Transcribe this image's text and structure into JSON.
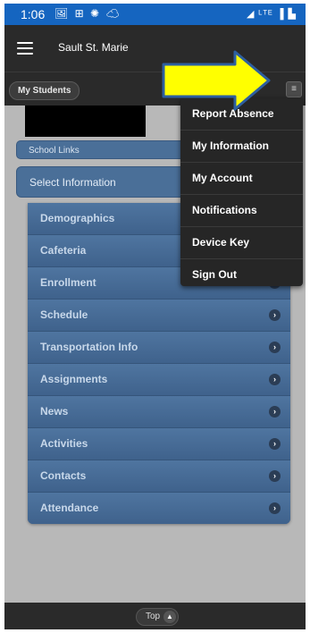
{
  "status_bar": {
    "time": "1:06",
    "notification_icons": "🖼 ⊞ ✺ ☁",
    "system_icons": "◢ ᴸᵀᴱ ▐ ▙"
  },
  "app_bar": {
    "title": "Sault St. Marie"
  },
  "sub_bar": {
    "my_students_label": "My Students",
    "menu_icon": "≡"
  },
  "school_links": {
    "label": "School Links"
  },
  "select_information": {
    "label": "Select Information"
  },
  "info_items": [
    "Demographics",
    "Cafeteria",
    "Enrollment",
    "Schedule",
    "Transportation Info",
    "Assignments",
    "News",
    "Activities",
    "Contacts",
    "Attendance"
  ],
  "dropdown_menu": [
    "Report Absence",
    "My Information",
    "My Account",
    "Notifications",
    "Device Key",
    "Sign Out"
  ],
  "bottom_bar": {
    "top_label": "Top"
  },
  "colors": {
    "accent_blue": "#1565c0",
    "arrow_yellow": "#ffff00",
    "list_blue": "#46699a",
    "dark_bar": "#2a2a2a"
  },
  "icons": {
    "chevron": "chevron-right-icon",
    "up": "chevron-up-icon"
  }
}
